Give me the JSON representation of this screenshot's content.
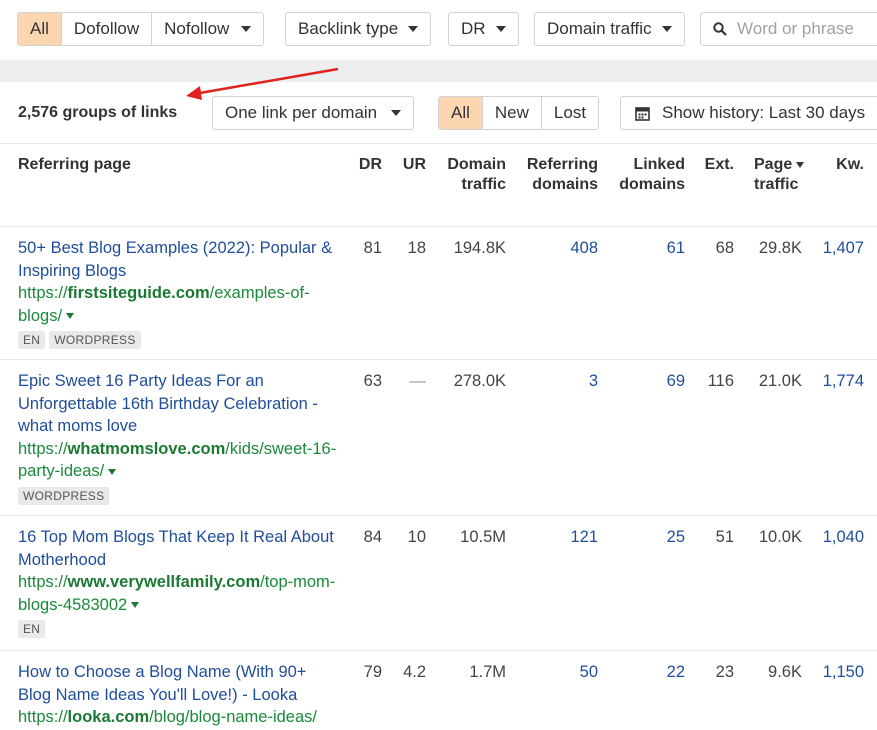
{
  "filters": {
    "all": "All",
    "dofollow": "Dofollow",
    "nofollow": "Nofollow",
    "backlink_type": "Backlink type",
    "dr": "DR",
    "domain_traffic": "Domain traffic",
    "search_placeholder": "Word or phrase"
  },
  "toolbar": {
    "groups_count": "2,576 groups of links",
    "grouping": "One link per domain",
    "tab_all": "All",
    "tab_new": "New",
    "tab_lost": "Lost",
    "history": "Show history: Last 30 days"
  },
  "columns": {
    "referring_page": "Referring page",
    "dr": "DR",
    "ur": "UR",
    "domain_traffic_1": "Domain",
    "domain_traffic_2": "traffic",
    "referring_domains_1": "Referring",
    "referring_domains_2": "domains",
    "linked_domains_1": "Linked",
    "linked_domains_2": "domains",
    "ext": "Ext.",
    "page_traffic_1": "Page",
    "page_traffic_2": "traffic",
    "kw": "Kw."
  },
  "rows": [
    {
      "title": "50+ Best Blog Examples (2022): Popular & Inspiring Blogs",
      "url_prefix": "https://",
      "url_domain": "firstsiteguide.com",
      "url_path": "/examples-of-blogs/",
      "tags": [
        "EN",
        "WORDPRESS"
      ],
      "dr": "81",
      "ur": "18",
      "domain_traffic": "194.8K",
      "referring_domains": "408",
      "linked_domains": "61",
      "ext": "68",
      "page_traffic": "29.8K",
      "kw": "1,407"
    },
    {
      "title": "Epic Sweet 16 Party Ideas For an Unforgettable 16th Birthday Celebration - what moms love",
      "url_prefix": "https://",
      "url_domain": "whatmomslove.com",
      "url_path": "/kids/sweet-16-party-ideas/",
      "tags": [
        "WORDPRESS"
      ],
      "dr": "63",
      "ur": "—",
      "domain_traffic": "278.0K",
      "referring_domains": "3",
      "linked_domains": "69",
      "ext": "116",
      "page_traffic": "21.0K",
      "kw": "1,774"
    },
    {
      "title": "16 Top Mom Blogs That Keep It Real About Motherhood",
      "url_prefix": "https://",
      "url_domain": "www.verywellfamily.com",
      "url_path": "/top-mom-blogs-4583002",
      "tags": [
        "EN"
      ],
      "dr": "84",
      "ur": "10",
      "domain_traffic": "10.5M",
      "referring_domains": "121",
      "linked_domains": "25",
      "ext": "51",
      "page_traffic": "10.0K",
      "kw": "1,040"
    },
    {
      "title": "How to Choose a Blog Name (With 90+ Blog Name Ideas You'll Love!) - Looka",
      "url_prefix": "https://",
      "url_domain": "looka.com",
      "url_path": "/blog/blog-name-ideas/",
      "tags": [],
      "dr": "79",
      "ur": "4.2",
      "domain_traffic": "1.7M",
      "referring_domains": "50",
      "linked_domains": "22",
      "ext": "23",
      "page_traffic": "9.6K",
      "kw": "1,150"
    }
  ]
}
